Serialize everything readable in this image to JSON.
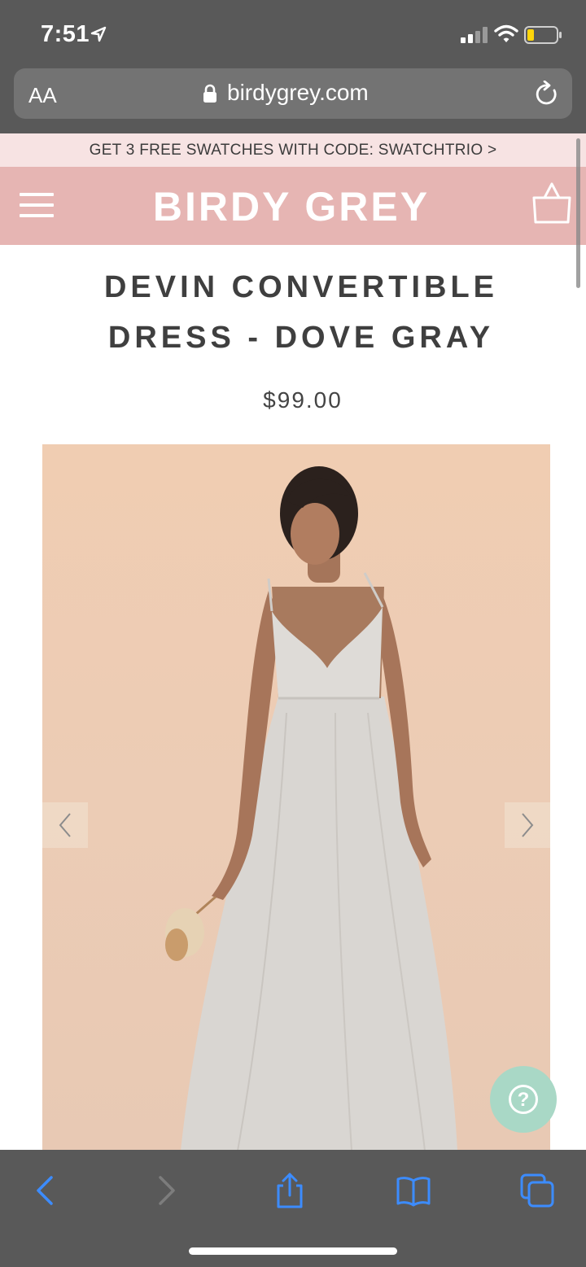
{
  "status": {
    "time": "7:51"
  },
  "browser": {
    "text_size_label": "AA",
    "url": "birdygrey.com"
  },
  "promo": {
    "text": "GET 3 FREE SWATCHES WITH CODE: SWATCHTRIO >"
  },
  "site": {
    "brand": "BIRDY GREY"
  },
  "product": {
    "title_line1": "DEVIN CONVERTIBLE",
    "title_line2": "DRESS - DOVE GRAY",
    "price": "$99.00",
    "image_alt": "Model wearing Devin Convertible Dress in Dove Gray holding dried bouquet"
  },
  "help": {
    "label": "?"
  },
  "colors": {
    "header_pink": "#e6b5b3",
    "promo_pink": "#f7e3e3",
    "help_mint": "#a9d8c6",
    "ios_blue": "#3c8cff",
    "chrome_gray": "#595959"
  }
}
